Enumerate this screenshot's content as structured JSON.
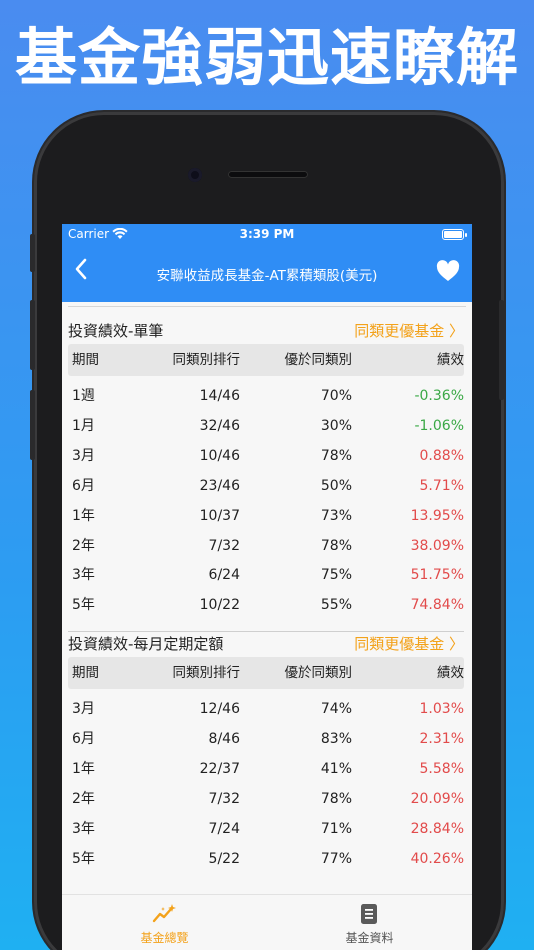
{
  "promo": {
    "title": "基金強弱迅速瞭解"
  },
  "status": {
    "carrier": "Carrier",
    "time": "3:39 PM"
  },
  "nav": {
    "title": "安聯收益成長基金-AT累積類股(美元)"
  },
  "colors": {
    "accent": "#2f8df5",
    "link": "#f3a21b",
    "positive": "#e24b4b",
    "negative": "#3aa845"
  },
  "sections": [
    {
      "title": "投資績效-單筆",
      "link": "同類更優基金 〉",
      "headers": [
        "期間",
        "同類別排行",
        "優於同類別",
        "績效"
      ],
      "rows": [
        [
          "1週",
          "14/46",
          "70%",
          "-0.36%"
        ],
        [
          "1月",
          "32/46",
          "30%",
          "-1.06%"
        ],
        [
          "3月",
          "10/46",
          "78%",
          "0.88%"
        ],
        [
          "6月",
          "23/46",
          "50%",
          "5.71%"
        ],
        [
          "1年",
          "10/37",
          "73%",
          "13.95%"
        ],
        [
          "2年",
          "7/32",
          "78%",
          "38.09%"
        ],
        [
          "3年",
          "6/24",
          "75%",
          "51.75%"
        ],
        [
          "5年",
          "10/22",
          "55%",
          "74.84%"
        ]
      ]
    },
    {
      "title": "投資績效-每月定期定額",
      "link": "同類更優基金 〉",
      "headers": [
        "期間",
        "同類別排行",
        "優於同類別",
        "績效"
      ],
      "rows": [
        [
          "3月",
          "12/46",
          "74%",
          "1.03%"
        ],
        [
          "6月",
          "8/46",
          "83%",
          "2.31%"
        ],
        [
          "1年",
          "22/37",
          "41%",
          "5.58%"
        ],
        [
          "2年",
          "7/32",
          "78%",
          "20.09%"
        ],
        [
          "3年",
          "7/24",
          "71%",
          "28.84%"
        ],
        [
          "5年",
          "5/22",
          "77%",
          "40.26%"
        ]
      ]
    }
  ],
  "tabs": [
    {
      "label": "基金總覽",
      "icon": "chart-sparkle-icon",
      "active": true,
      "color": "#f3a21b"
    },
    {
      "label": "基金資料",
      "icon": "document-icon",
      "active": false,
      "color": "#555555"
    }
  ]
}
